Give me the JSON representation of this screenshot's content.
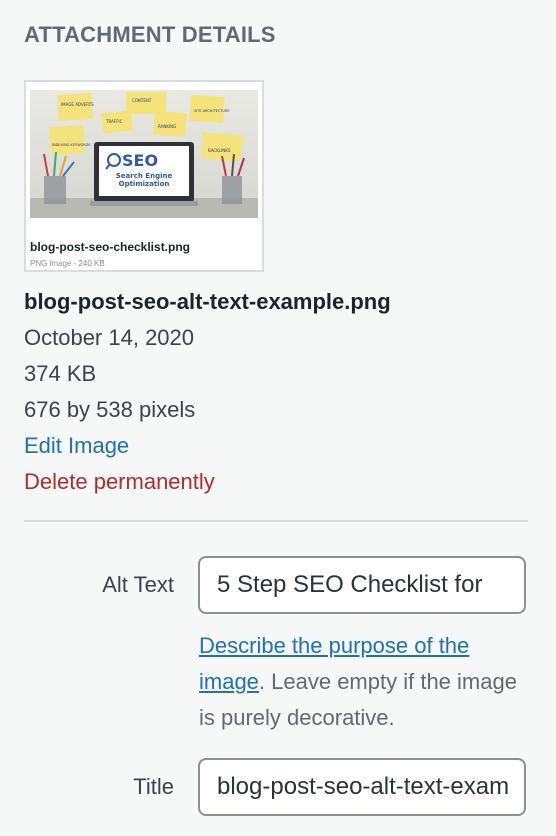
{
  "panel": {
    "heading": "ATTACHMENT DETAILS"
  },
  "thumbnail": {
    "caption_name": "blog-post-seo-checklist.png",
    "caption_meta": "PNG image - 240 KB",
    "image_text": {
      "seo": "SEO",
      "subtitle_line1": "Search Engine",
      "subtitle_line2": "Optimization",
      "note_content": "CONTENT",
      "note_traffic": "TRAFFIC",
      "note_ranking": "RANKING",
      "note_backlinks": "BACKLINKS",
      "note_indexing": "INDEXING KEYWORDS",
      "note_image": "IMAGE ADVERTS",
      "note_site": "SITE ARCHITECTURE"
    }
  },
  "details": {
    "filename": "blog-post-seo-alt-text-example.png",
    "date": "October 14, 2020",
    "filesize": "374 KB",
    "dimensions": "676 by 538 pixels",
    "edit_link": "Edit Image",
    "delete_link": "Delete permanently"
  },
  "form": {
    "alt_label": "Alt Text",
    "alt_value": "5 Step SEO Checklist for",
    "help_link": "Describe the purpose of the image",
    "help_rest": ". Leave empty if the image is purely decorative.",
    "title_label": "Title",
    "title_value": "blog-post-seo-alt-text-example"
  },
  "colors": {
    "link": "#2271b1",
    "delete": "#b32d2e",
    "heading": "#646970",
    "background": "#f6f7f7"
  }
}
